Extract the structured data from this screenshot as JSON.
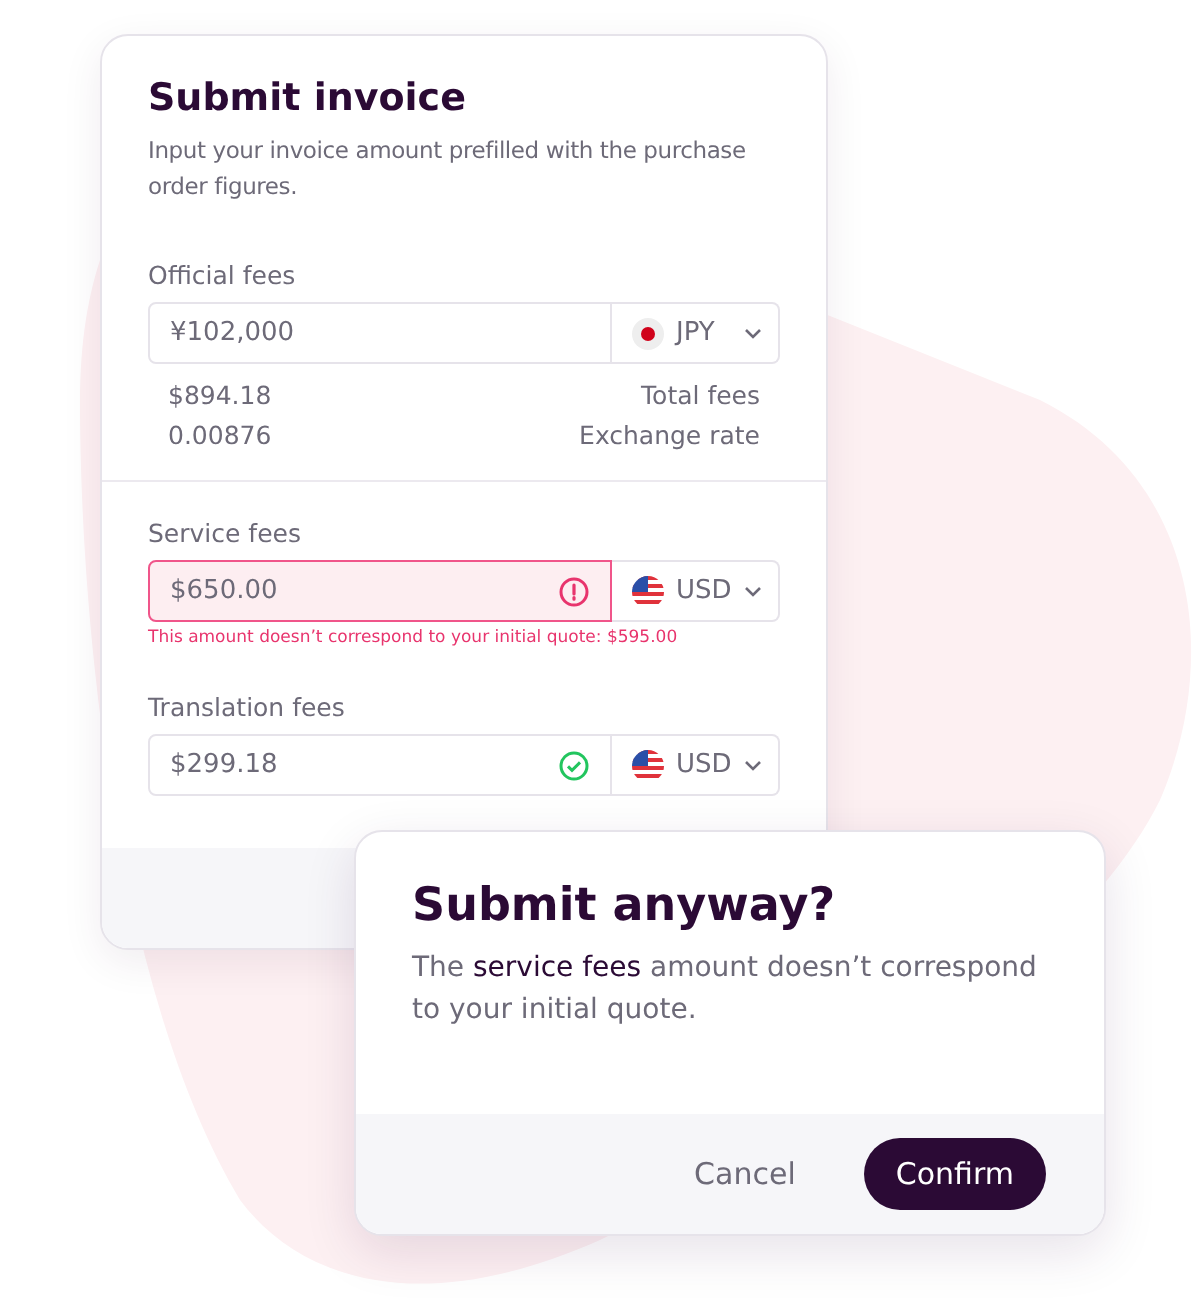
{
  "invoice": {
    "title": "Submit invoice",
    "description": "Input your invoice amount prefilled with the purchase order figures.",
    "official": {
      "label": "Official fees",
      "value": "¥102,000",
      "currency": {
        "kind": "jp",
        "code": "JPY"
      },
      "details": [
        {
          "value": "$894.18",
          "label": "Total fees"
        },
        {
          "value": "0.00876",
          "label": "Exchange rate"
        }
      ]
    },
    "fees": [
      {
        "label": "Service fees",
        "value": "$650.00",
        "kind": "error",
        "error": "This amount doesn’t correspond to your initial quote: $595.00",
        "currency": {
          "kind": "us",
          "code": "USD"
        }
      },
      {
        "label": "Translation fees",
        "value": "$299.18",
        "kind": "valid",
        "currency": {
          "kind": "us",
          "code": "USD"
        }
      }
    ]
  },
  "dialog": {
    "title": "Submit anyway?",
    "message": "The **service fees** amount doesn’t correspond to your initial quote.",
    "buttons": [
      {
        "label": "Cancel",
        "kind": "secondary"
      },
      {
        "label": "Confirm",
        "kind": "primary"
      }
    ]
  }
}
